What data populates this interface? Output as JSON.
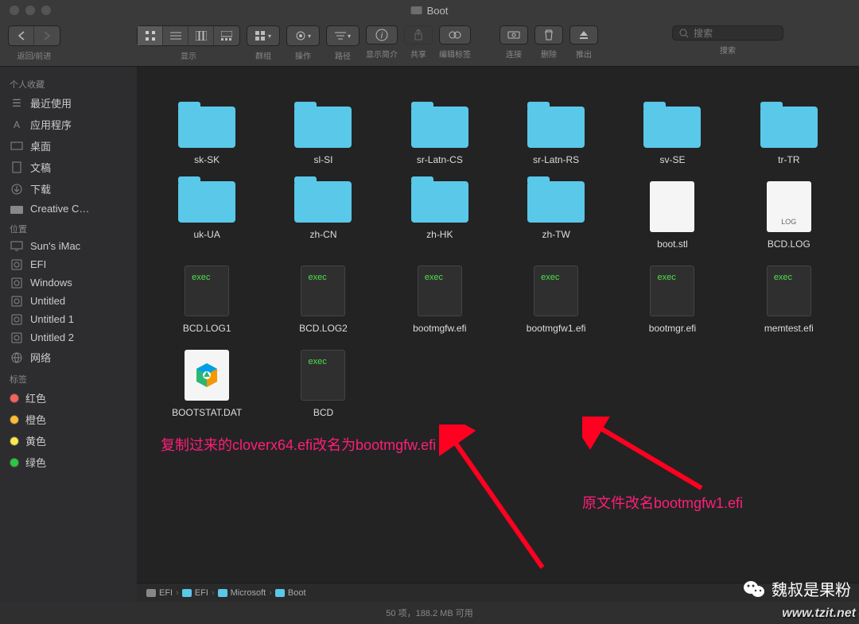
{
  "window": {
    "title": "Boot"
  },
  "toolbar": {
    "nav_label": "返回/前进",
    "view_label": "显示",
    "group_label": "群组",
    "action_label": "操作",
    "path_label": "路径",
    "info_label": "显示简介",
    "share_label": "共享",
    "tags_label": "编辑标签",
    "connect_label": "连接",
    "delete_label": "删除",
    "eject_label": "推出",
    "search_label": "搜索",
    "search_placeholder": "搜索"
  },
  "sidebar": {
    "favorites": {
      "header": "个人收藏",
      "items": [
        "最近使用",
        "应用程序",
        "桌面",
        "文稿",
        "下载",
        "Creative C…"
      ]
    },
    "locations": {
      "header": "位置",
      "items": [
        "Sun's iMac",
        "EFI",
        "Windows",
        "Untitled",
        "Untitled 1",
        "Untitled 2",
        "网络"
      ]
    },
    "tags": {
      "header": "标签",
      "items": [
        {
          "label": "红色",
          "class": "tag-red"
        },
        {
          "label": "橙色",
          "class": "tag-orange"
        },
        {
          "label": "黄色",
          "class": "tag-yellow"
        },
        {
          "label": "绿色",
          "class": "tag-green"
        }
      ]
    }
  },
  "files": {
    "row1": [
      "sk-SK",
      "sl-SI",
      "sr-Latn-CS",
      "sr-Latn-RS",
      "sv-SE",
      "tr-TR"
    ],
    "row2": [
      "uk-UA",
      "zh-CN",
      "zh-HK",
      "zh-TW",
      "boot.stl",
      "BCD.LOG"
    ],
    "row3": [
      "BCD.LOG1",
      "BCD.LOG2",
      "bootmgfw.efi",
      "bootmgfw1.efi",
      "bootmgr.efi",
      "memtest.efi"
    ],
    "row4": [
      "BOOTSTAT.DAT",
      "BCD"
    ],
    "exec_label": "exec",
    "log_label": "LOG"
  },
  "annotations": {
    "left": "复制过来的cloverx64.efi改名为bootmgfw.efi",
    "right": "原文件改名bootmgfw1.efi"
  },
  "path": {
    "segments": [
      "EFI",
      "EFI",
      "Microsoft",
      "Boot"
    ]
  },
  "status": {
    "text": "50 项，188.2 MB 可用"
  },
  "watermark": {
    "text": "魏叔是果粉",
    "url": "www.tzit.net"
  }
}
